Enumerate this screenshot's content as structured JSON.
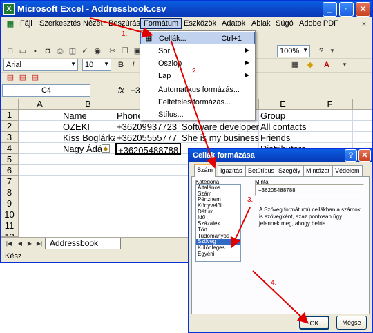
{
  "window": {
    "title": "Microsoft Excel - Addressbook.csv",
    "minimize": "_",
    "maximize": "▫",
    "close": "✕"
  },
  "menu": [
    "Fájl",
    "Szerkesztés",
    "Nézet",
    "Beszúrás",
    "Formátum",
    "Eszközök",
    "Adatok",
    "Ablak",
    "Súgó",
    "Adobe PDF"
  ],
  "toolbar": {
    "zoom": "100%",
    "font": "Arial",
    "size": "10"
  },
  "formula": {
    "cell_ref": "C4",
    "fx": "fx",
    "value": "+3"
  },
  "format_menu": {
    "items": [
      {
        "label": "Cellák...",
        "shortcut": "Ctrl+1",
        "submenu": false
      },
      {
        "label": "Sor",
        "shortcut": "",
        "submenu": true
      },
      {
        "label": "Oszlop",
        "shortcut": "",
        "submenu": true
      },
      {
        "label": "Lap",
        "shortcut": "",
        "submenu": true
      },
      {
        "label": "Automatikus formázás...",
        "shortcut": "",
        "submenu": false
      },
      {
        "label": "Feltételes formázás...",
        "shortcut": "",
        "submenu": false
      },
      {
        "label": "Stílus...",
        "shortcut": "",
        "submenu": false
      }
    ]
  },
  "sheet": {
    "columns": [
      "A",
      "B",
      "C",
      "D",
      "E",
      "F"
    ],
    "rows": [
      "1",
      "2",
      "3",
      "4",
      "5",
      "6",
      "7",
      "8",
      "9",
      "10",
      "11",
      "12"
    ],
    "cells": {
      "B1": "Name",
      "C1": "Phone",
      "E1": "Group",
      "B2": "OZEKI",
      "C2": "+36209937723",
      "D2": "Software developer",
      "E2": " All contacts",
      "B3": "Kiss Boglárka",
      "C3": "+36205555777",
      "D3": "She is my business",
      "E3": "Friends",
      "B4": "Nagy Ádá",
      "C4": "+36205488788",
      "E4": "Distributors"
    },
    "tab": "Addressbook",
    "status": "Kész"
  },
  "dialog": {
    "title": "Cellák formázása",
    "help": "?",
    "close": "✕",
    "tabs": [
      "Szám",
      "Igazítás",
      "Betűtípus",
      "Szegély",
      "Mintázat",
      "Védelem"
    ],
    "category_label": "Kategória:",
    "categories": [
      "Általános",
      "Szám",
      "Pénznem",
      "Könyvelői",
      "Dátum",
      "Idő",
      "Százalék",
      "Tört",
      "Tudományos",
      "Szöveg",
      "Különleges",
      "Egyéni"
    ],
    "selected_category": "Szöveg",
    "sample_label": "Minta",
    "sample_value": "+36205488788",
    "description": "A Szöveg formátumú cellákban a számok is szövegként, azaz pontosan úgy jelennek meg, ahogy beírta.",
    "ok": "OK",
    "cancel": "Mégse"
  },
  "annotations": [
    "1.",
    "2.",
    "3.",
    "4."
  ],
  "colors": {
    "annotation": "#e00000",
    "titlebar": "#0a5ee3",
    "highlight": "#c1d2ee",
    "selection": "#316ac5"
  }
}
